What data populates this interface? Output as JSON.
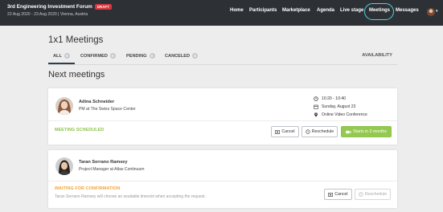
{
  "header": {
    "event_title": "3rd Engineering Investment Forum",
    "draft_badge": "DRAFT",
    "event_subtitle": "22 Aug 2020 - 23 Aug 2020 | Vienna, Austria",
    "nav": [
      "Home",
      "Participants",
      "Marketplace",
      "Agenda",
      "Live stage",
      "Meetings",
      "Messages"
    ],
    "active_nav": "Meetings",
    "accent_color": "#4fd3e0"
  },
  "page": {
    "title": "1x1 Meetings",
    "tabs": [
      {
        "label": "ALL",
        "count": "0"
      },
      {
        "label": "CONFIRMED",
        "count": "0"
      },
      {
        "label": "PENDING",
        "count": "0"
      },
      {
        "label": "CANCELED",
        "count": "0"
      }
    ],
    "active_tab": "ALL",
    "availability_label": "AVAILABILITY",
    "section_title": "Next meetings"
  },
  "meetings": [
    {
      "name": "Adina Schneider",
      "role": "PM at The Swiss Space Center",
      "time": "10:20 - 10:40",
      "date": "Sunday, August 23",
      "location": "Online Video Conference",
      "status": "MEETING SCHEDULED",
      "status_color": "#8bc34a",
      "cancel_label": "Cancel",
      "reschedule_label": "Reschedule",
      "start_label": "Starts in 2 months"
    },
    {
      "name": "Taran Serrano Ramsey",
      "role": "Project Manager at Atlas Continuum",
      "status": "WAITING FOR CONFIRMATION",
      "status_color": "#f0a43a",
      "note": "Taran Serrano Ramsey will choose an available timeslot when accepting the request.",
      "cancel_label": "Cancel",
      "reschedule_label": "Reschedule"
    }
  ]
}
